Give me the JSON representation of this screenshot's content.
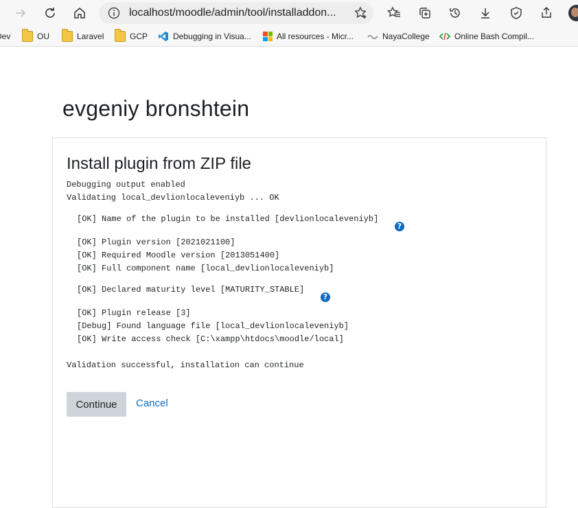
{
  "browser": {
    "url": "localhost/moodle/admin/tool/installaddon...",
    "bookmarks": [
      {
        "label": "Dev",
        "icon": "folder-icon"
      },
      {
        "label": "OU",
        "icon": "folder-icon"
      },
      {
        "label": "Laravel",
        "icon": "folder-icon"
      },
      {
        "label": "GCP",
        "icon": "folder-icon"
      },
      {
        "label": "Debugging in Visua...",
        "icon": "vscode-icon"
      },
      {
        "label": "All resources - Micr...",
        "icon": "microsoft-icon"
      },
      {
        "label": "NayaCollege",
        "icon": "naya-icon"
      },
      {
        "label": "Online Bash Compil...",
        "icon": "code-icon"
      }
    ]
  },
  "page": {
    "user_name": "evgeniy bronshtein",
    "heading": "Install plugin from ZIP file",
    "debug_line": "Debugging output enabled",
    "validating_line": "Validating local_devlionlocaleveniyb ... OK",
    "checks": [
      "[OK] Name of the plugin to be installed [devlionlocaleveniyb]",
      "[OK] Plugin version [2021021100]",
      "[OK] Required Moodle version [2013051400]",
      "[OK] Full component name [local_devlionlocaleveniyb]",
      "[OK] Declared maturity level [MATURITY_STABLE]",
      "[OK] Plugin release [3]",
      "[Debug] Found language file [local_devlionlocaleveniyb]",
      "[OK] Write access check [C:\\xampp\\htdocs\\moodle/local]"
    ],
    "result_line": "Validation successful, installation can continue",
    "continue_label": "Continue",
    "cancel_label": "Cancel"
  },
  "colors": {
    "link": "#0f6cbf",
    "button_bg": "#ced4da",
    "help_icon": "#0f6cbf"
  }
}
